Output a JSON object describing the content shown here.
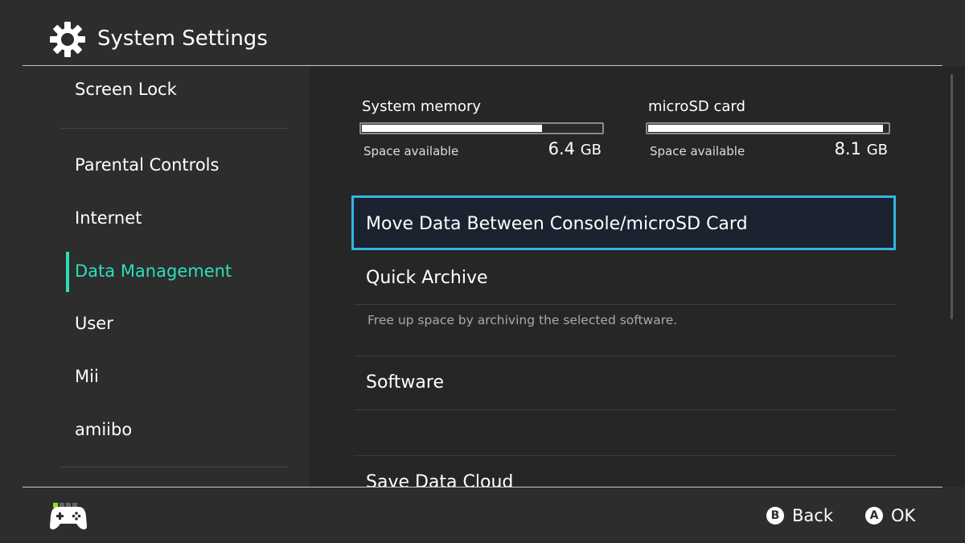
{
  "header": {
    "title": "System Settings",
    "icon": "gear-icon"
  },
  "sidebar": {
    "items": [
      {
        "label": "Screen Lock"
      },
      {
        "label": "Parental Controls"
      },
      {
        "label": "Internet"
      },
      {
        "label": "Data Management",
        "active": true
      },
      {
        "label": "User"
      },
      {
        "label": "Mii"
      },
      {
        "label": "amiibo"
      }
    ]
  },
  "storage": {
    "system": {
      "label": "System memory",
      "space_label": "Space available",
      "value": "6.4",
      "unit": "GB",
      "fill_fraction": 0.75
    },
    "microsd": {
      "label": "microSD card",
      "space_label": "Space available",
      "value": "8.1",
      "unit": "GB",
      "fill_fraction": 0.98
    }
  },
  "menu": {
    "items": [
      {
        "label": "Move Data Between Console/microSD Card",
        "selected": true
      },
      {
        "label": "Quick Archive",
        "description": "Free up space by archiving the selected software."
      },
      {
        "label": "Software"
      },
      {
        "label": "Save Data Cloud"
      }
    ]
  },
  "footer": {
    "back": {
      "button": "B",
      "label": "Back"
    },
    "ok": {
      "button": "A",
      "label": "OK"
    },
    "controller_icon": "controller-icon"
  },
  "colors": {
    "accent": "#29e0b7",
    "selection": "#33b5e5",
    "indicator_on": "#9bdb22"
  }
}
